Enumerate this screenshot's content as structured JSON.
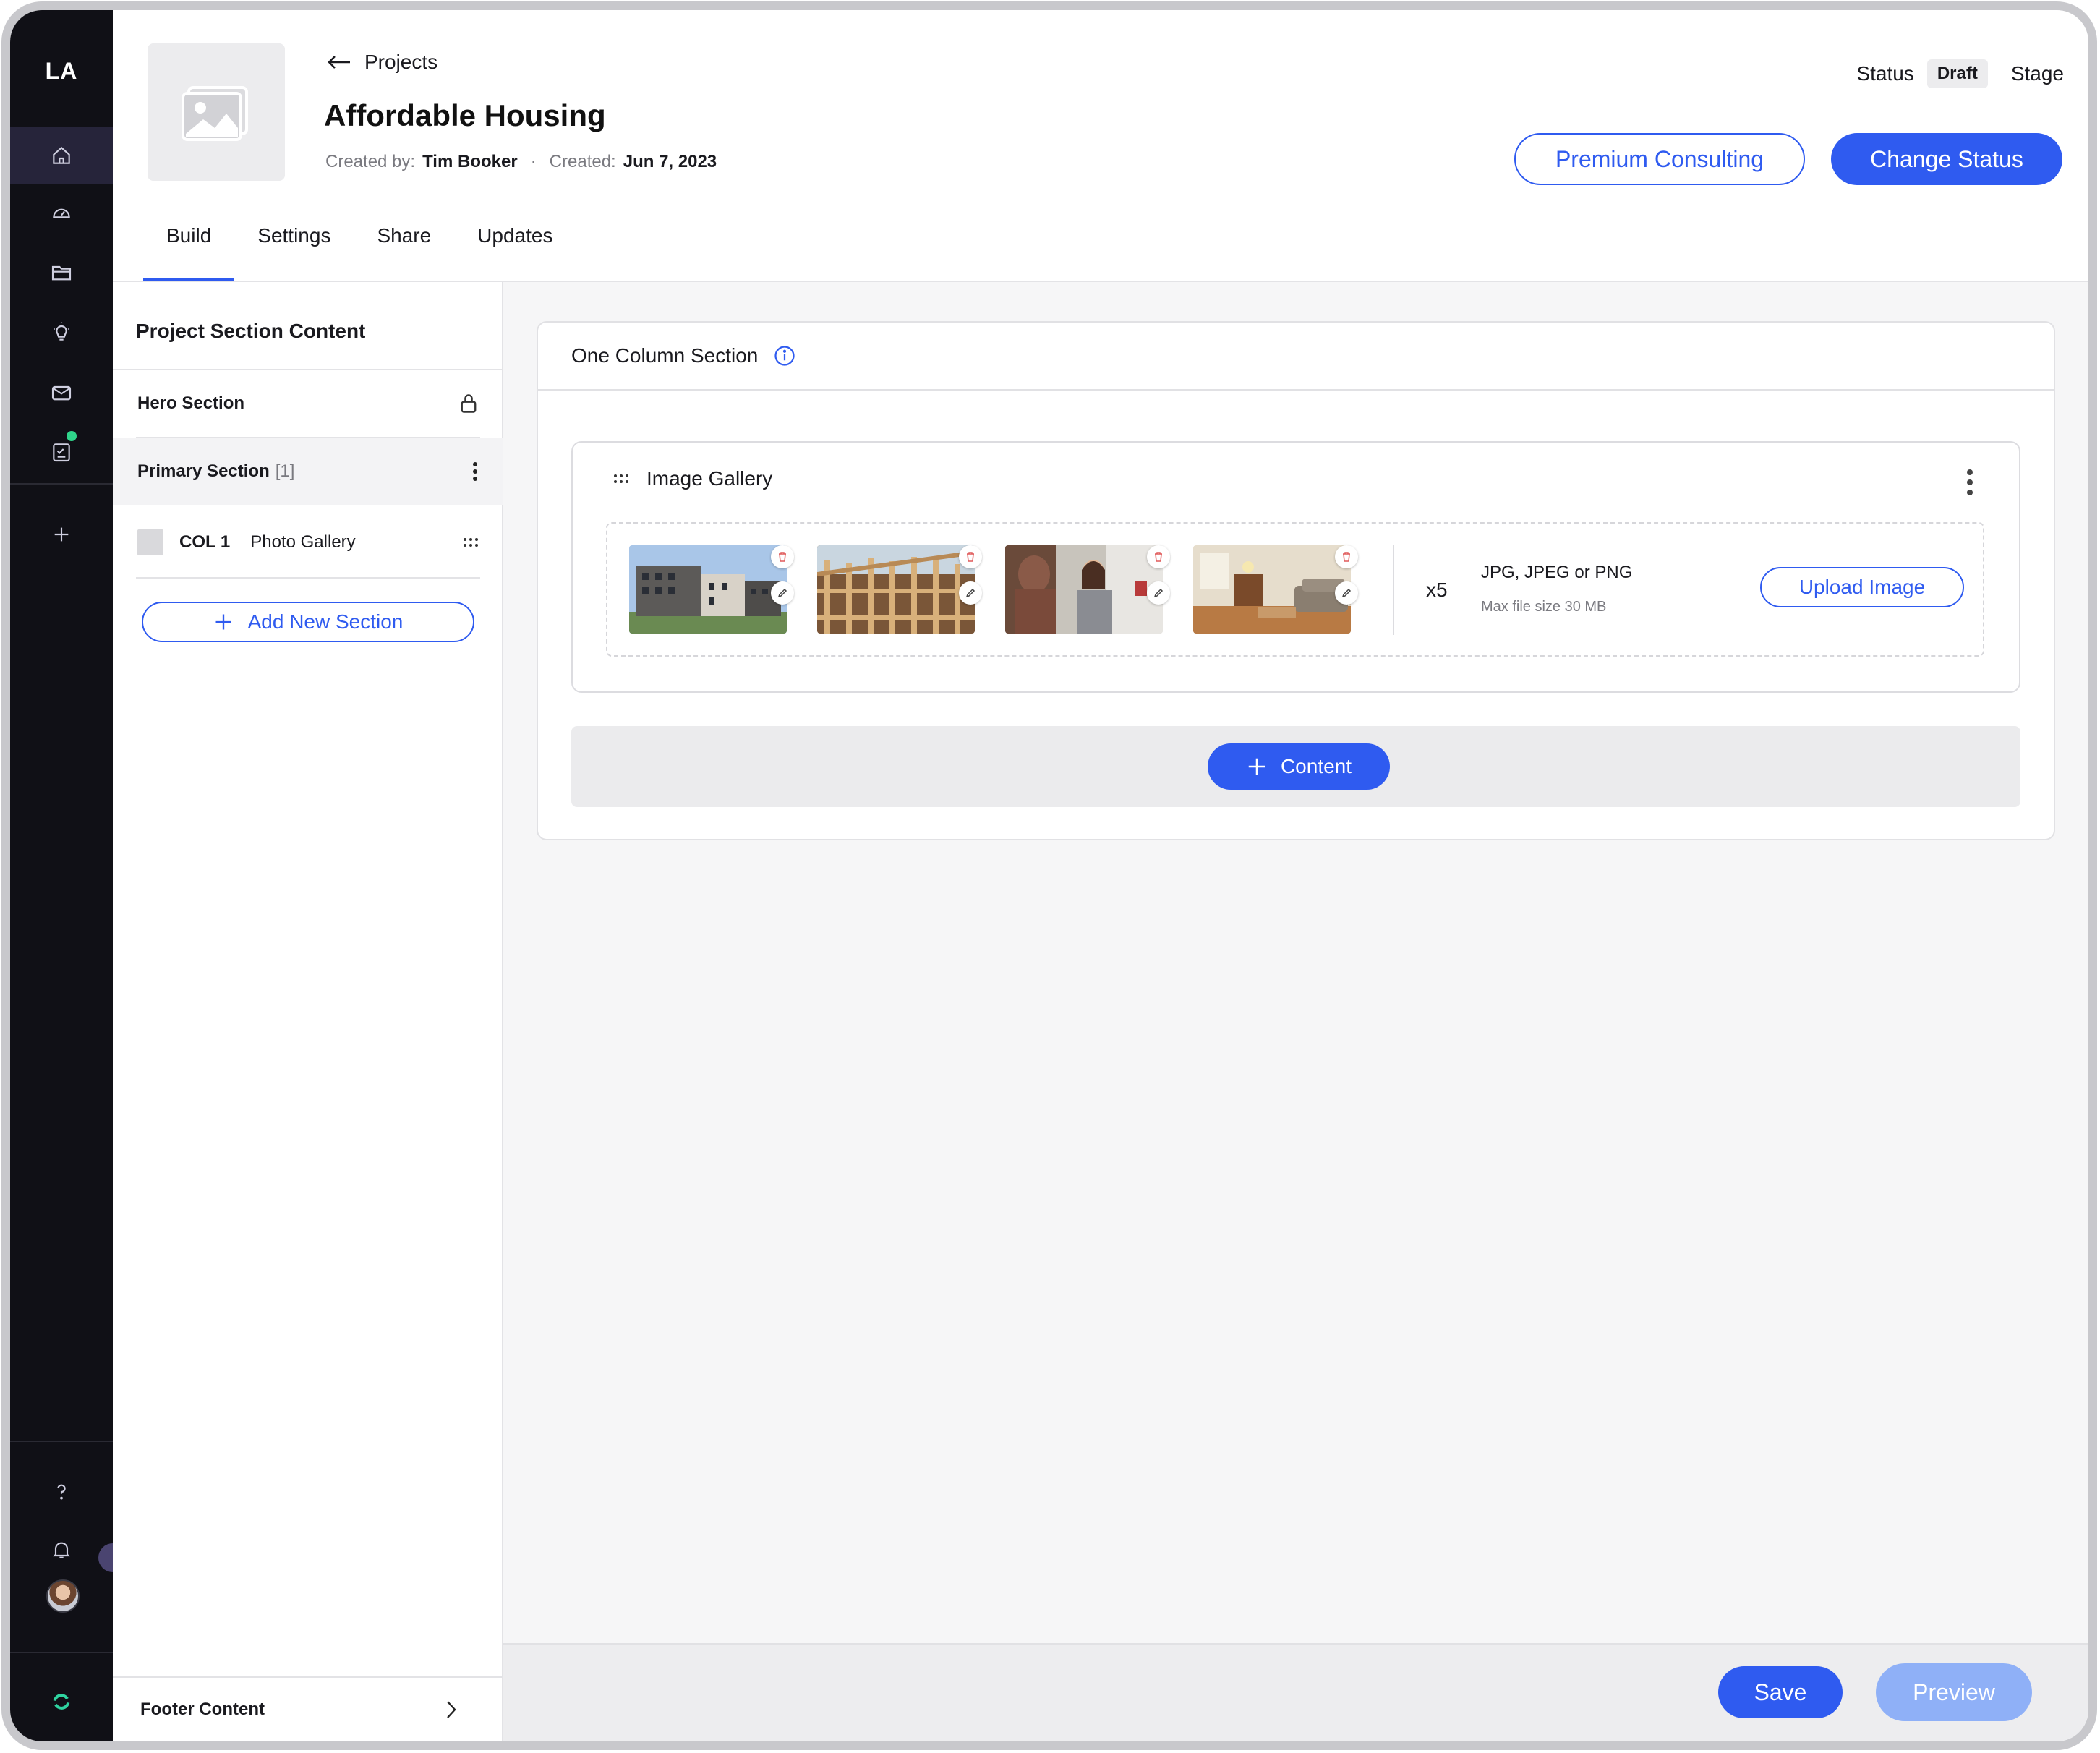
{
  "sidebar": {
    "logo": "LA",
    "items": [
      {
        "icon": "home-icon",
        "active": true
      },
      {
        "icon": "dashboard-gauge-icon"
      },
      {
        "icon": "folder-icon"
      },
      {
        "icon": "lightbulb-icon"
      },
      {
        "icon": "mail-icon"
      },
      {
        "icon": "checklist-icon",
        "dot_color": "#2fd48a"
      },
      {
        "icon": "plus-icon"
      }
    ],
    "bottom": [
      {
        "icon": "help-icon",
        "label": "?"
      },
      {
        "icon": "bell-icon"
      },
      {
        "icon": "avatar"
      },
      {
        "icon": "sync-icon",
        "color": "#2fd4a0"
      }
    ]
  },
  "header": {
    "back_label": "Projects",
    "title": "Affordable Housing",
    "created_by_label": "Created by:",
    "created_by": "Tim Booker",
    "separator": "·",
    "created_label": "Created:",
    "created_date": "Jun 7, 2023",
    "status_label": "Status",
    "status_value": "Draft",
    "stage_label": "Stage",
    "premium_button": "Premium Consulting",
    "change_status_button": "Change Status",
    "tabs": [
      {
        "label": "Build",
        "active": true
      },
      {
        "label": "Settings"
      },
      {
        "label": "Share"
      },
      {
        "label": "Updates"
      }
    ]
  },
  "left_panel": {
    "title": "Project Section Content",
    "hero_section": "Hero Section",
    "primary_section": "Primary Section",
    "primary_count": "[1]",
    "col_label": "COL 1",
    "col_content": "Photo Gallery",
    "add_section_button": "Add New Section",
    "footer_label": "Footer Content"
  },
  "main": {
    "section_title": "One Column Section",
    "gallery_title": "Image Gallery",
    "image_count": "x5",
    "formats": "JPG, JPEG or PNG",
    "max_size": "Max file size 30 MB",
    "upload_button": "Upload Image",
    "content_button": "Content",
    "save_button": "Save",
    "preview_button": "Preview"
  },
  "colors": {
    "accent": "#2f5bf0",
    "sidebar_bg": "#101016",
    "preview_disabled": "#8fb0f7"
  }
}
